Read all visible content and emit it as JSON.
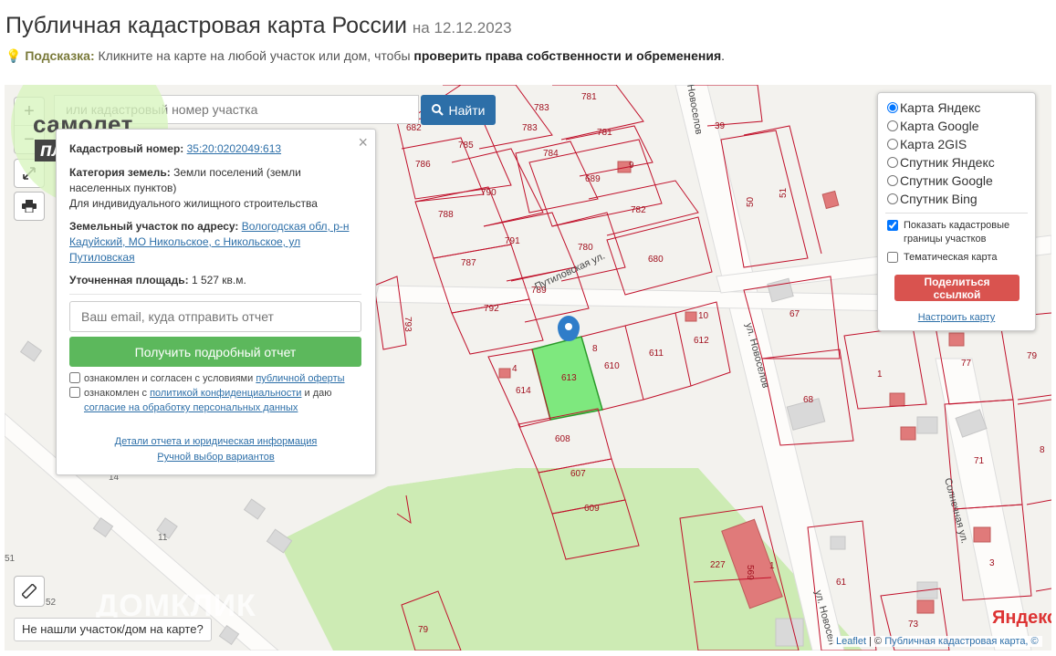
{
  "header": {
    "title": "Публичная кадастровая карта России",
    "date": "на 12.12.2023"
  },
  "hint": {
    "label": "Подсказка:",
    "text": "Кликните на карте на любой участок или дом, чтобы",
    "bold": "проверить права собственности и обременения",
    "end": "."
  },
  "logo": {
    "line1": "самолет",
    "line2": "плюс"
  },
  "search": {
    "placeholder": "или кадастровый номер участка",
    "button": "Найти"
  },
  "zoom": {
    "in": "+",
    "out": "−"
  },
  "info_panel": {
    "close": "×",
    "cad_label": "Кадастровый номер:",
    "cad_value": "35:20:0202049:613",
    "cat_label": "Категория земель:",
    "cat_value": "Земли поселений (земли населенных пунктов)",
    "use_value": "Для индивидуального жилищного строительства",
    "addr_label": "Земельный участок по адресу:",
    "addr_value": "Вологодская обл, р-н Кадуйский, МО Никольское, с Никольское, ул Путиловская",
    "area_label": "Уточненная площадь:",
    "area_value": "1 527 кв.м.",
    "email_placeholder": "Ваш email, куда отправить отчет",
    "report_button": "Получить подробный отчет",
    "agree1_text": "ознакомлен и согласен с условиями",
    "agree1_link": "публичной оферты",
    "agree2_text": "ознакомлен с",
    "agree2_link": "политикой конфиденциальности",
    "agree2_mid": "и даю",
    "agree2_link2": "согласие на обработку персональных данных",
    "details_link": "Детали отчета и юридическая информация",
    "manual_link": "Ручной выбор вариантов"
  },
  "layers": {
    "options": [
      "Карта Яндекс",
      "Карта Google",
      "Карта 2GIS",
      "Спутник Яндекс",
      "Спутник Google",
      "Спутник Bing"
    ],
    "selected": "Карта Яндекс",
    "show_boundaries": "Показать кадастровые границы участков",
    "thematic": "Тематическая карта",
    "share_button": "Поделиться ссылкой",
    "configure_link": "Настроить карту"
  },
  "map": {
    "parcels": [
      "783",
      "781",
      "682",
      "785",
      "783",
      "784",
      "781",
      "786",
      "790",
      "689",
      "9",
      "788",
      "782",
      "791",
      "780",
      "787",
      "680",
      "792",
      "789",
      "793",
      "4",
      "8",
      "10",
      "614",
      "613",
      "610",
      "611",
      "612",
      "608",
      "607",
      "609",
      "67",
      "77",
      "79",
      "1",
      "68",
      "71",
      "8",
      "50",
      "51",
      "39",
      "227",
      "569",
      "1",
      "61",
      "3",
      "73",
      "79",
      "14",
      "11",
      "51",
      "52"
    ],
    "streets": [
      "Путиловская ул.",
      "ул. Новоселов",
      "Новоселов",
      "Солнечная ул.",
      "ул. Новосел"
    ],
    "highlight_color": "#7ee87e",
    "boundary_color": "#c0102a"
  },
  "bottom": {
    "not_found": "Не нашли участок/дом на карте?",
    "watermark": "ДОМКЛИК",
    "yandex": "Яндекс",
    "leaflet": "Leaflet",
    "attrib_sep": "| ©",
    "attrib_link": "Публичная кадастровая карта, ©"
  }
}
